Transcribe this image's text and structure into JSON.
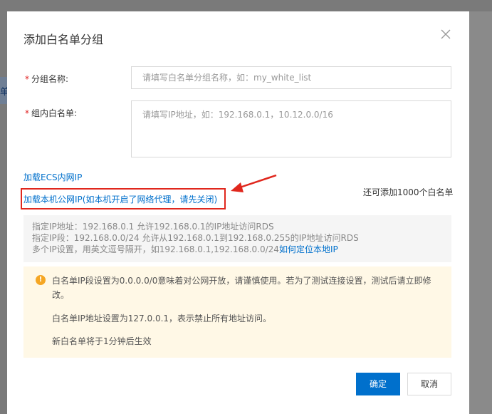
{
  "background": {
    "left_text": "单"
  },
  "modal": {
    "title": "添加白名单分组",
    "close_icon": "close-icon"
  },
  "form": {
    "group_name": {
      "label": "分组名称:",
      "placeholder": "请填写白名单分组名称，如：my_white_list"
    },
    "whitelist": {
      "label": "组内白名单:",
      "placeholder": "请填写IP地址，如：192.168.0.1，10.12.0.0/16"
    },
    "required_mark": "*"
  },
  "links": {
    "load_ecs": "加载ECS内网IP",
    "load_local": "加载本机公网IP(如本机开启了网络代理，请先关闭)"
  },
  "quota_text": "还可添加1000个白名单",
  "hint": {
    "line1": "指定IP地址：192.168.0.1 允许192.168.0.1的IP地址访问RDS",
    "line2": "指定IP段：192.168.0.0/24 允许从192.168.0.1到192.168.0.255的IP地址访问RDS",
    "line3": "多个IP设置，用英文逗号隔开，如192.168.0.1,192.168.0.0/24",
    "line3_link": "如何定位本地IP"
  },
  "warning": {
    "icon": "warning-icon",
    "p1": "白名单IP段设置为0.0.0.0/0意味着对公网开放，请谨慎使用。若为了测试连接设置，测试后请立即修改。",
    "p2": "白名单IP地址设置为127.0.0.1，表示禁止所有地址访问。",
    "p3": "新白名单将于1分钟后生效"
  },
  "buttons": {
    "confirm": "确定",
    "cancel": "取消"
  },
  "colors": {
    "primary": "#0070cc",
    "annotation_red": "#e0271d",
    "warning": "#f5a623"
  }
}
